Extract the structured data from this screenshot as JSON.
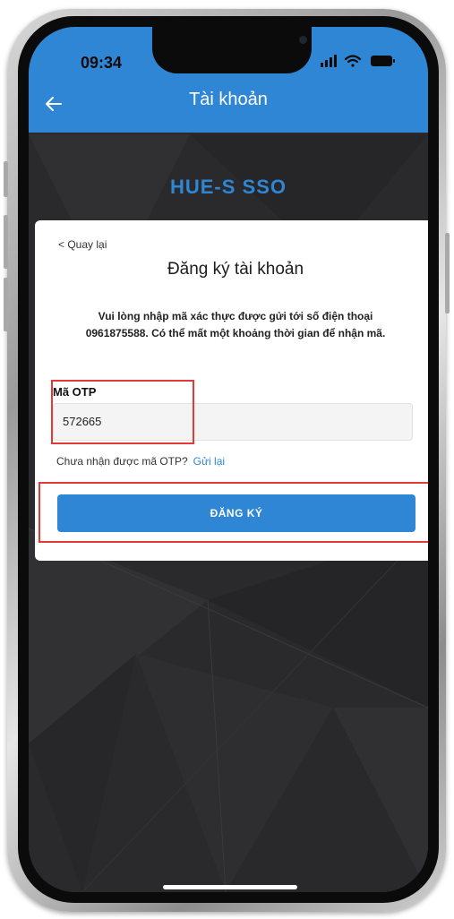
{
  "status_bar": {
    "time": "09:34",
    "icons": [
      "cellular-signal-icon",
      "wifi-icon",
      "battery-icon"
    ]
  },
  "header": {
    "title": "Tài khoản",
    "back_icon": "arrow-left-icon"
  },
  "brand": {
    "name": "HUE-S SSO"
  },
  "form": {
    "back_label": "< Quay lại",
    "title": "Đăng ký tài khoản",
    "instruction": "Vui lòng nhập mã xác thực được gửi tới số điện thoại 0961875588. Có thể mất một khoảng thời gian để nhận mã.",
    "otp_label": "Mã OTP",
    "otp_value": "572665",
    "resend_question": "Chưa nhận được mã OTP?",
    "resend_link": "Gửi lại",
    "submit_label": "ĐĂNG KÝ"
  },
  "colors": {
    "accent": "#2f86d4",
    "highlight": "#e53935",
    "background": "#2b2b2d"
  }
}
